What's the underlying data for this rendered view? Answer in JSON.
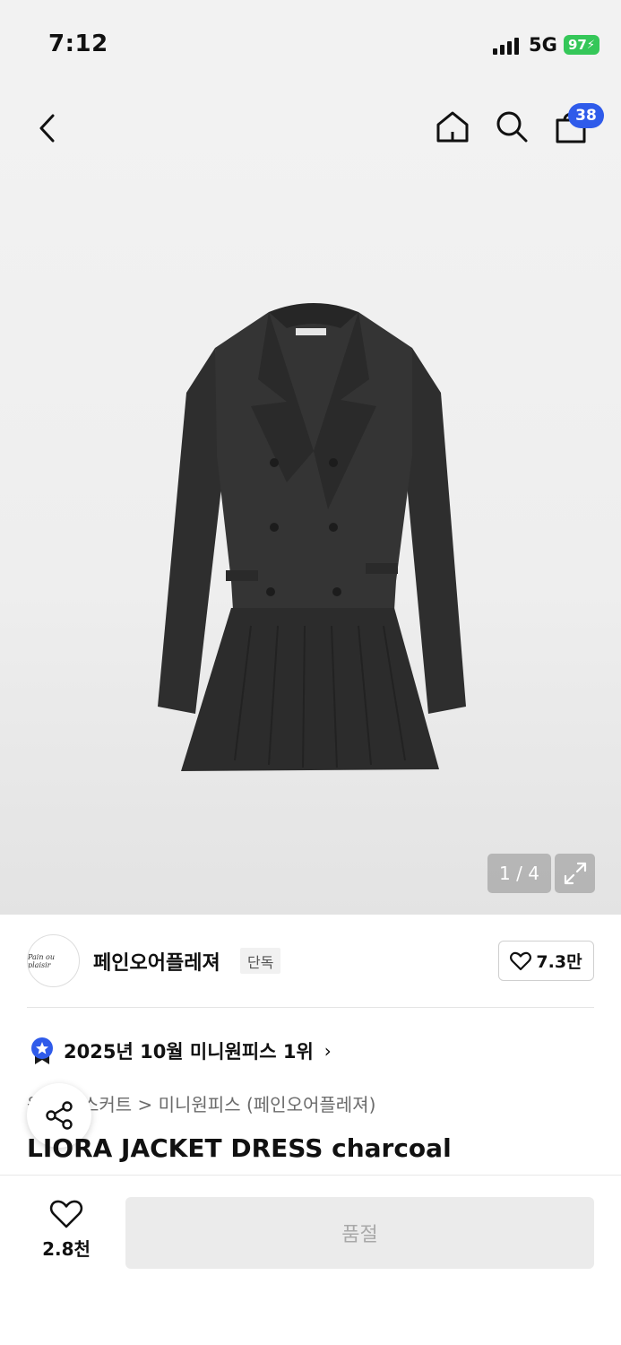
{
  "status_bar": {
    "time": "7:12",
    "network": "5G",
    "battery": "97"
  },
  "header": {
    "back_icon": "chevron-left-icon",
    "home_icon": "home-icon",
    "search_icon": "search-icon",
    "cart_icon": "shopping-bag-icon",
    "cart_count": "38",
    "badge_color": "#2f5bea"
  },
  "gallery": {
    "pager": "1 / 4",
    "expand_icon": "expand-icon"
  },
  "brand": {
    "logo_text": "Pain ou plaisir",
    "name": "페인오어플레져",
    "exclusive_badge": "단독",
    "like_count": "7.3만"
  },
  "ranking": {
    "text": "2025년 10월 미니원피스 1위",
    "icon": "ranking-medal-icon"
  },
  "breadcrumb": {
    "text": "원피스/스커트 > 미니원피스 (페인오어플레져)"
  },
  "product": {
    "title": "LIORA JACKET DRESS charcoal"
  },
  "bottom_bar": {
    "wish_icon": "heart-icon",
    "wish_count": "2.8천",
    "soldout_label": "품절"
  },
  "colors": {
    "accent": "#2f5bea",
    "battery": "#35c759",
    "disabled_bg": "#ebebeb"
  }
}
